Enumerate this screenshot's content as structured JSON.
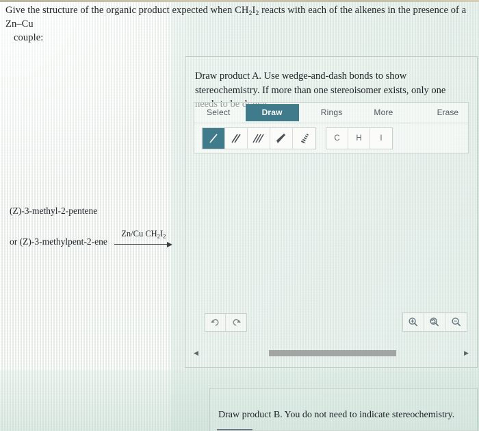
{
  "question": {
    "line1": "Give the structure of the organic product expected when CH",
    "sub1": "2",
    "line1b": "I",
    "sub2": "2",
    "line1c": " reacts with each of the alkenes in the presence of a Zn–Cu",
    "line2": "couple:"
  },
  "reactant": {
    "name_primary": "(Z)-3-methyl-2-pentene",
    "name_alternate": "or (Z)-3-methylpent-2-ene",
    "reagent_label": "Zn/Cu CH",
    "reagent_sub1": "2",
    "reagent_mid": "I",
    "reagent_sub2": "2",
    "arrow": "reaction-arrow"
  },
  "panel_a": {
    "instruction_line1": "Draw product A. Use wedge-and-dash bonds to show stereochemistry. If",
    "instruction_line2": "more than one stereoisomer exists, only one needs to be drawn.",
    "toolbar": {
      "tabs": [
        {
          "label": "Select",
          "active": false
        },
        {
          "label": "Draw",
          "active": true
        },
        {
          "label": "Rings",
          "active": false
        },
        {
          "label": "More",
          "active": false
        }
      ],
      "erase_label": "Erase",
      "bond_tools": [
        {
          "name": "single-bond",
          "active": true
        },
        {
          "name": "double-bond",
          "active": false
        },
        {
          "name": "triple-bond",
          "active": false
        },
        {
          "name": "wedge-bond",
          "active": false
        },
        {
          "name": "dash-bond",
          "active": false
        }
      ],
      "atom_tools": [
        {
          "label": "C"
        },
        {
          "label": "H"
        },
        {
          "label": "I"
        }
      ]
    },
    "controls": {
      "undo": "undo-icon",
      "redo": "redo-icon",
      "zoom_in": "zoom-in-icon",
      "zoom_reset": "zoom-reset-icon",
      "zoom_out": "zoom-out-icon"
    },
    "scrollbar": {
      "left_arrow": "◀",
      "right_arrow": "▶"
    }
  },
  "panel_b": {
    "instruction": "Draw product B. You do not need to indicate stereochemistry."
  },
  "colors": {
    "accent_teal": "#3f7b8b",
    "panel_border": "#c3cbc6",
    "text": "#1d2125",
    "scrollbar_thumb": "#8d8d8d"
  }
}
